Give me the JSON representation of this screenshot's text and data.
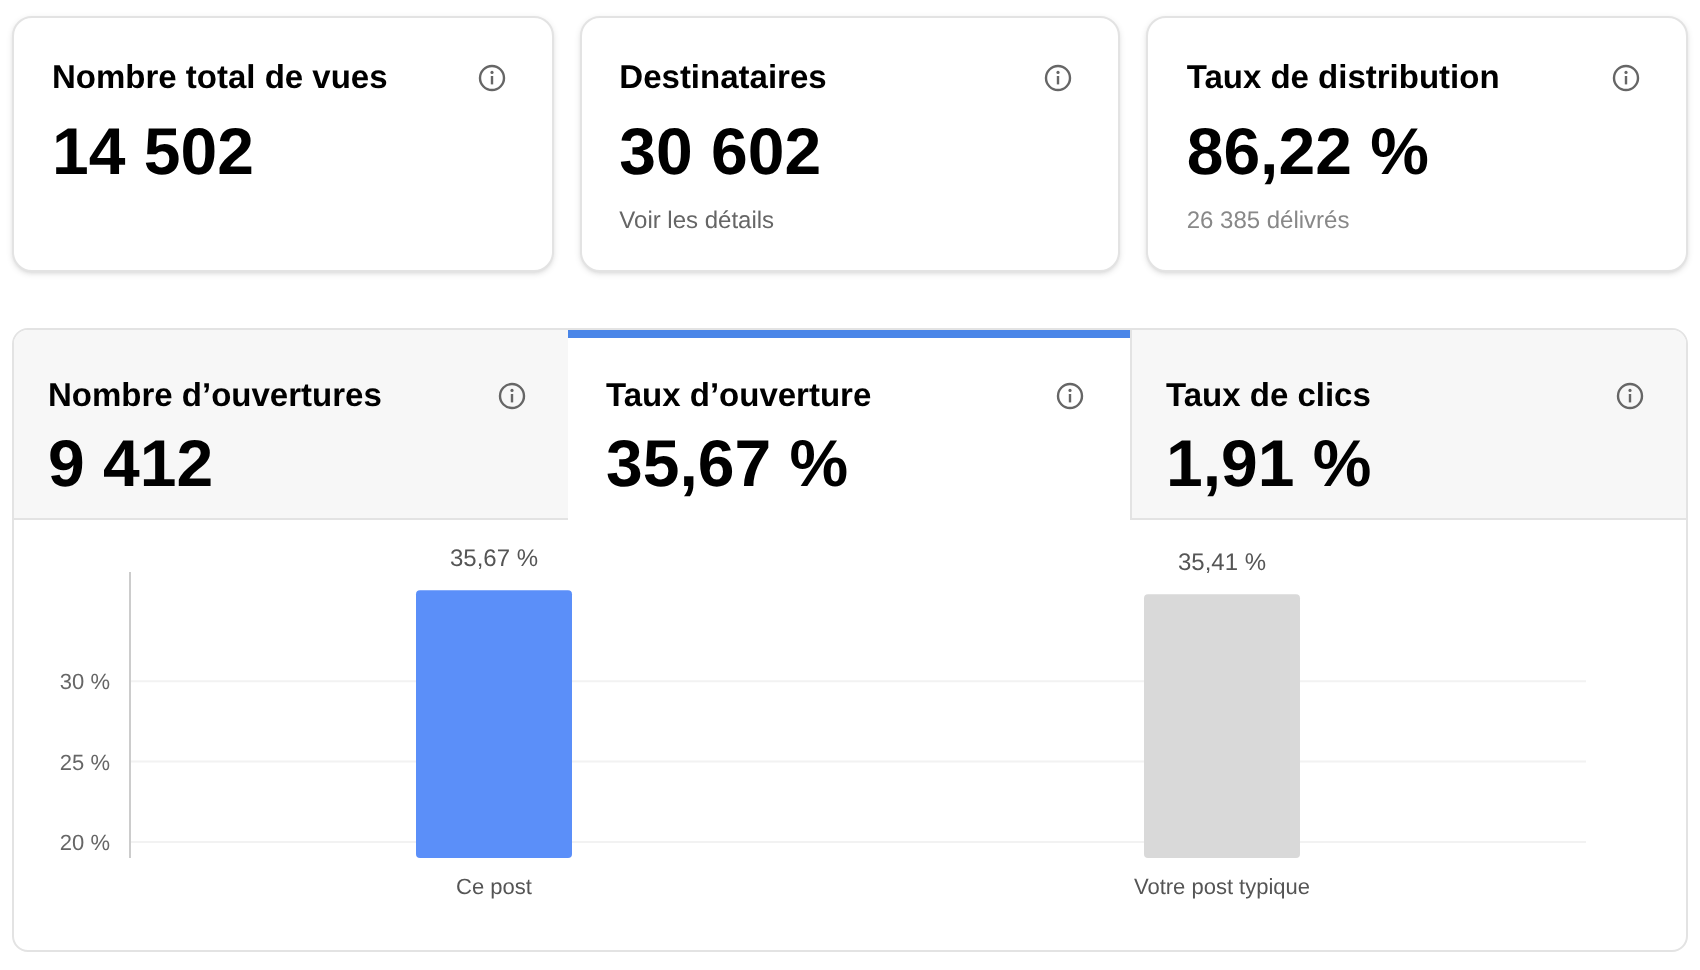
{
  "cards": [
    {
      "title": "Nombre total de vues",
      "value": "14 502"
    },
    {
      "title": "Destinataires",
      "value": "30 602",
      "subtitle": {
        "kind": "link",
        "text": "Voir les détails"
      }
    },
    {
      "title": "Taux de distribution",
      "value": "86,22 %",
      "subtitle": {
        "kind": "text",
        "text": "26 385 délivrés"
      }
    }
  ],
  "tabs": [
    {
      "title": "Nombre d’ouvertures",
      "value": "9 412",
      "selected": false
    },
    {
      "title": "Taux d’ouverture",
      "value": "35,67 %",
      "selected": true
    },
    {
      "title": "Taux de clics",
      "value": "1,91 %",
      "selected": false
    }
  ],
  "chart_data": {
    "type": "bar",
    "categories": [
      "Ce post",
      "Votre post typique"
    ],
    "values": [
      35.67,
      35.41
    ],
    "colors": [
      "#5b8ff9",
      "#d9d9d9"
    ],
    "value_labels": [
      "35,67 %",
      "35,41 %"
    ],
    "grid": true,
    "ylim": [
      19,
      36.8
    ],
    "yticks": [
      {
        "value": 20,
        "label": "20 %"
      },
      {
        "value": 25,
        "label": "25 %"
      },
      {
        "value": 30,
        "label": "30 %"
      }
    ]
  }
}
